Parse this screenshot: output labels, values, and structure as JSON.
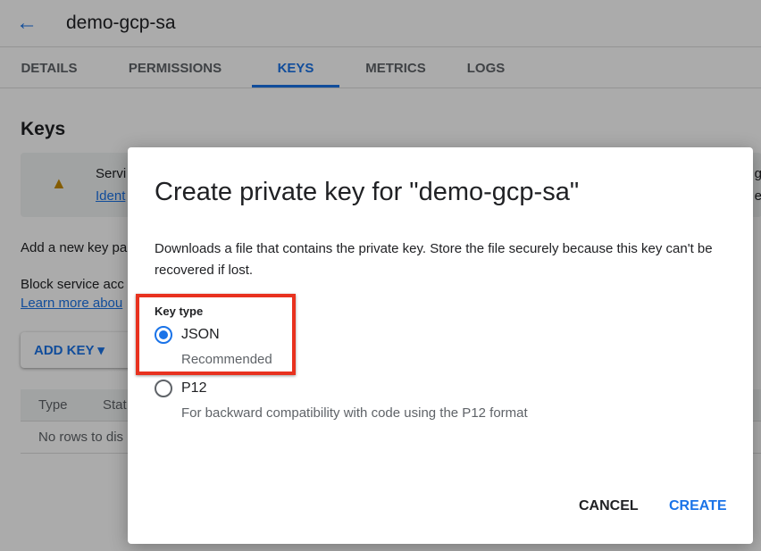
{
  "header": {
    "title": "demo-gcp-sa",
    "back_icon": "arrow-left-icon"
  },
  "tabs": [
    {
      "label": "DETAILS"
    },
    {
      "label": "PERMISSIONS"
    },
    {
      "label": "KEYS",
      "active": true
    },
    {
      "label": "METRICS"
    },
    {
      "label": "LOGS"
    }
  ],
  "page": {
    "heading": "Keys",
    "warning": {
      "icon": "warning-icon",
      "line1": "Servi",
      "line2": "Ident",
      "right1": "g",
      "right2": "e"
    },
    "add_text": "Add a new key pa",
    "block_text": "Block service acc",
    "learn_link": "Learn more abou",
    "add_key_label": "ADD KEY",
    "table": {
      "columns": [
        "Type",
        "Stat"
      ],
      "empty": "No rows to dis"
    }
  },
  "dialog": {
    "title": "Create private key for \"demo-gcp-sa\"",
    "description": "Downloads a file that contains the private key. Store the file securely because this key can't be recovered if lost.",
    "key_type_label": "Key type",
    "options": [
      {
        "label": "JSON",
        "sub": "Recommended",
        "selected": true
      },
      {
        "label": "P12",
        "sub": "For backward compatibility with code using the P12 format",
        "selected": false
      }
    ],
    "cancel": "CANCEL",
    "create": "CREATE",
    "highlight_color": "#e8321f",
    "accent": "#1a73e8"
  }
}
